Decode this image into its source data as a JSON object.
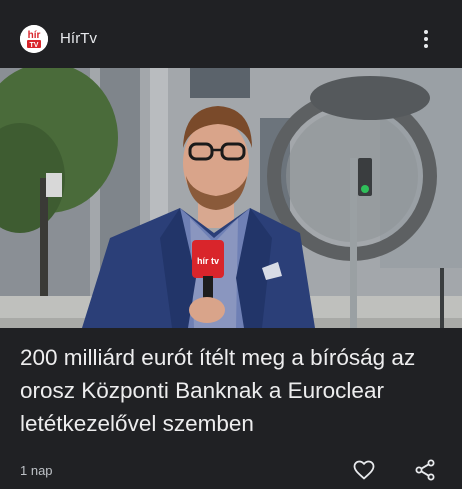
{
  "source": {
    "name": "HírTv",
    "logo_text_top": "hír",
    "logo_text_bottom": "TV",
    "logo_color": "#d9252b"
  },
  "article": {
    "headline": "200 milliárd eurót ítélt meg a bíróság az orosz Központi Banknak a Euroclear letétkezelővel szemben",
    "time": "1 nap"
  },
  "microphone": {
    "flag_text": "hír tv"
  },
  "icons": {
    "more": "more-vert-icon",
    "like": "heart-outline-icon",
    "share": "share-icon"
  },
  "colors": {
    "background": "#202124",
    "text": "#e8eaed",
    "secondary_text": "#bdc1c6",
    "brand_red": "#d9252b"
  }
}
